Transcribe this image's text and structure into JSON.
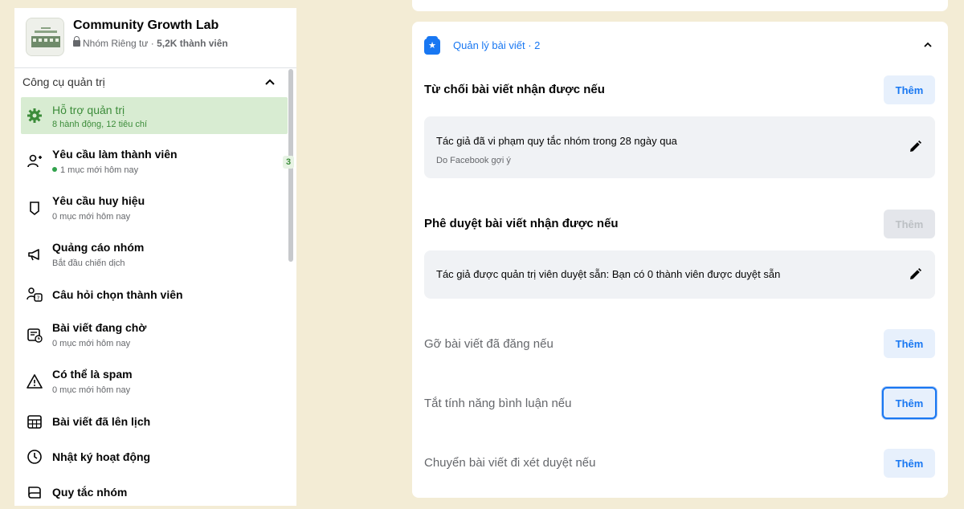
{
  "group": {
    "name": "Community Growth Lab",
    "privacy": "Nhóm Riêng tư · ",
    "members": "5,2K thành viên"
  },
  "sidebar": {
    "section_title": "Công cụ quản trị",
    "items": [
      {
        "label": "Hỗ trợ quản trị",
        "sub": "8 hành động, 12 tiêu chí",
        "icon": "gear-icon",
        "active": true
      },
      {
        "label": "Yêu cầu làm thành viên",
        "sub": "1 mục mới hôm nay",
        "icon": "add-person-icon",
        "badge": "3"
      },
      {
        "label": "Yêu cầu huy hiệu",
        "sub": "0 mục mới hôm nay",
        "icon": "badge-icon"
      },
      {
        "label": "Quảng cáo nhóm",
        "sub": "Bắt đầu chiến dịch",
        "icon": "megaphone-icon"
      },
      {
        "label": "Câu hỏi chọn thành viên",
        "icon": "person-question-icon"
      },
      {
        "label": "Bài viết đang chờ",
        "sub": "0 mục mới hôm nay",
        "icon": "pending-post-icon"
      },
      {
        "label": "Có thể là spam",
        "sub": "0 mục mới hôm nay",
        "icon": "warning-icon"
      },
      {
        "label": "Bài viết đã lên lịch",
        "icon": "calendar-icon"
      },
      {
        "label": "Nhật ký hoạt động",
        "icon": "clock-icon"
      },
      {
        "label": "Quy tắc nhóm",
        "icon": "book-icon"
      }
    ]
  },
  "main": {
    "section_title": "Quản lý bài viết · 2",
    "add_label": "Thêm",
    "rules": [
      {
        "title": "Từ chối bài viết nhận được nếu",
        "condition": "Tác giả đã vi phạm quy tắc nhóm trong 28 ngày qua",
        "condition_sub": "Do Facebook gợi ý"
      },
      {
        "title": "Phê duyệt bài viết nhận được nếu",
        "condition": "Tác giả được quản trị viên duyệt sẵn: Bạn có 0 thành viên được duyệt sẵn"
      },
      {
        "title": "Gỡ bài viết đã đăng nếu"
      },
      {
        "title": "Tắt tính năng bình luận nếu"
      },
      {
        "title": "Chuyển bài viết đi xét duyệt nếu"
      }
    ]
  },
  "colors": {
    "background": "#f3ecd5",
    "accent": "#1877f2",
    "active_green": "#3c8c3a",
    "active_bg": "#d8ecd2"
  }
}
